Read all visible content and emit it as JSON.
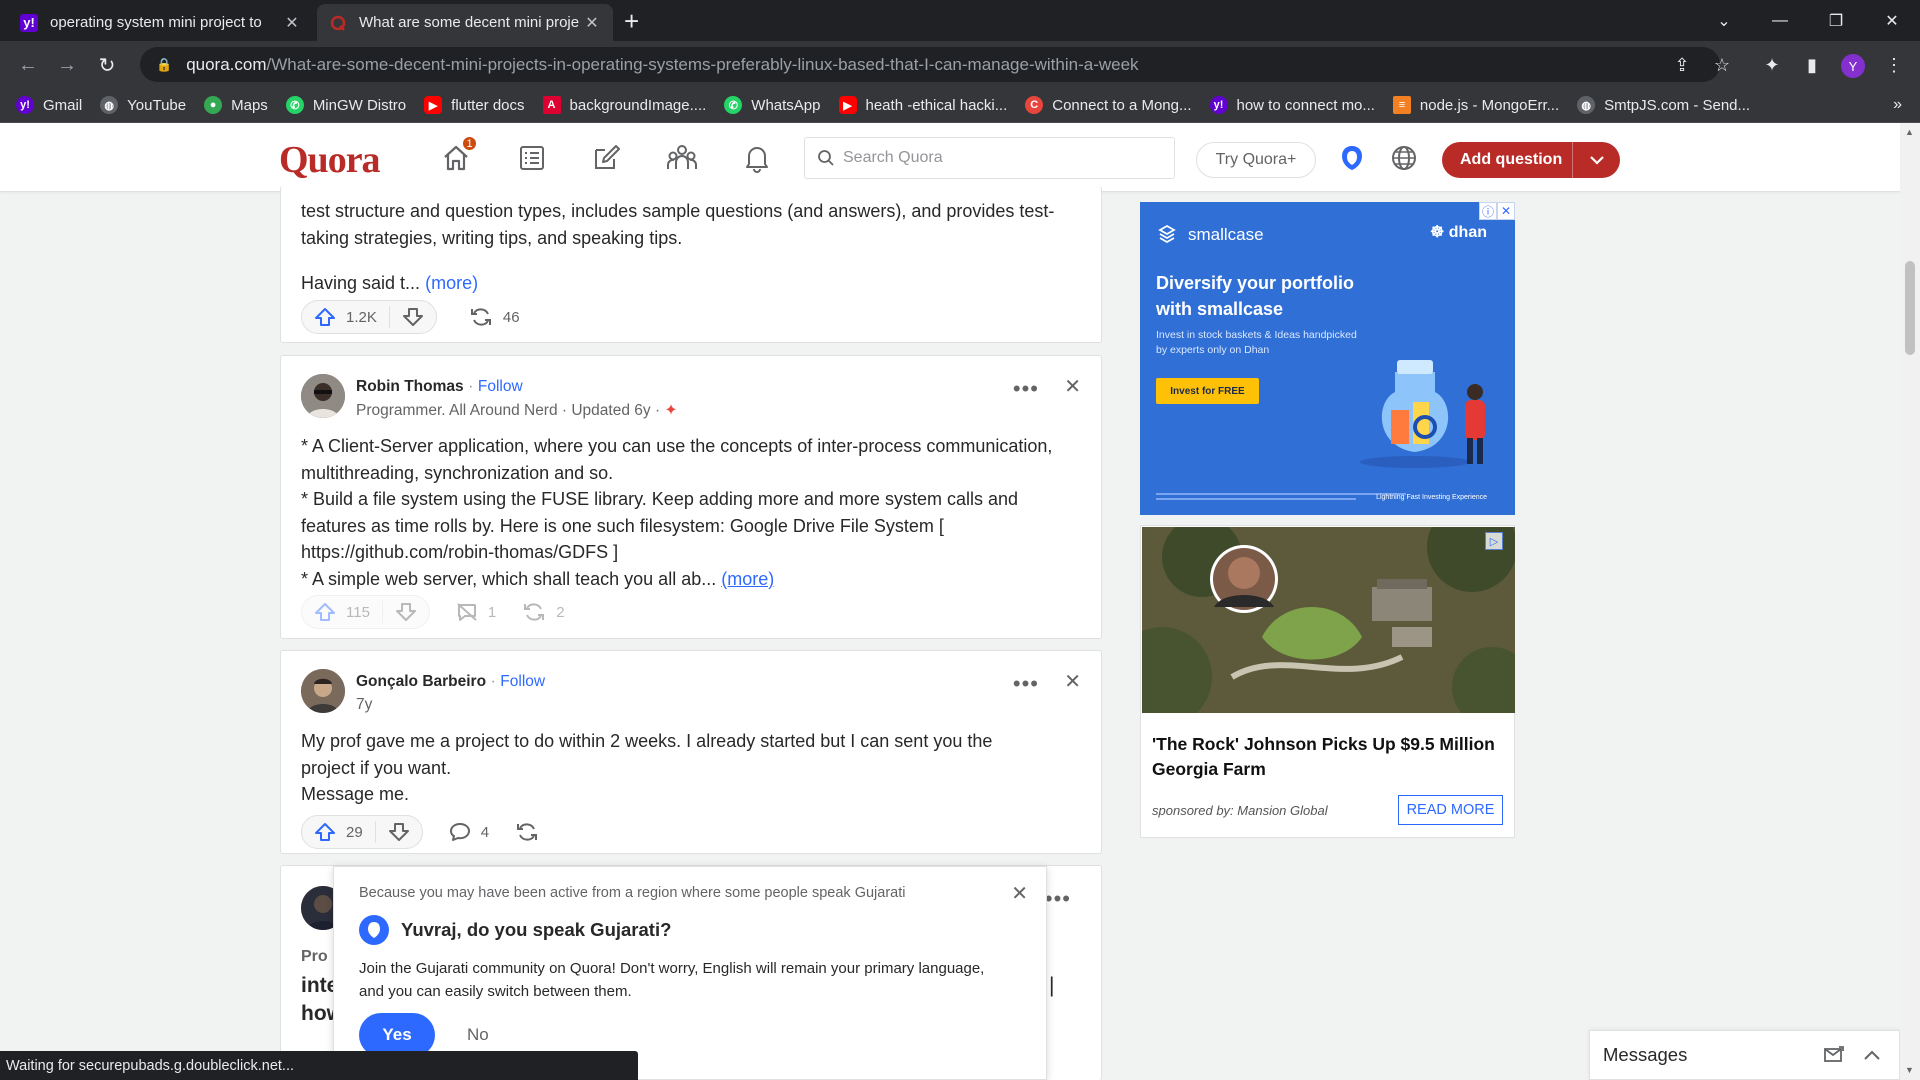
{
  "browser": {
    "tabs": [
      {
        "title": "operating system mini project to",
        "favicon": "yahoo-icon",
        "active": false
      },
      {
        "title": "What are some decent mini proje",
        "favicon": "quora-icon",
        "active": true
      }
    ],
    "url_host": "quora.com",
    "url_path": "/What-are-some-decent-mini-projects-in-operating-systems-preferably-linux-based-that-I-can-manage-within-a-week",
    "profile_initial": "Y",
    "bookmarks": [
      {
        "label": "Gmail",
        "icon": "yahoo-icon",
        "color": "#6001d2"
      },
      {
        "label": "YouTube",
        "icon": "globe-icon",
        "color": "#5f6368"
      },
      {
        "label": "Maps",
        "icon": "maps-pin-icon",
        "color": "#34a853"
      },
      {
        "label": "MinGW Distro",
        "icon": "whatsapp-icon",
        "color": "#25d366"
      },
      {
        "label": "flutter docs",
        "icon": "youtube-icon",
        "color": "#ff0000"
      },
      {
        "label": "backgroundImage....",
        "icon": "angular-icon",
        "color": "#dd0031"
      },
      {
        "label": "WhatsApp",
        "icon": "whatsapp-icon",
        "color": "#25d366"
      },
      {
        "label": "heath -ethical hacki...",
        "icon": "youtube-icon",
        "color": "#ff0000"
      },
      {
        "label": "Connect to a Mong...",
        "icon": "c-icon",
        "color": "#e8453c"
      },
      {
        "label": "how to connect mo...",
        "icon": "yahoo-icon",
        "color": "#6001d2"
      },
      {
        "label": "node.js - MongoErr...",
        "icon": "stackoverflow-icon",
        "color": "#f48024"
      },
      {
        "label": "SmtpJS.com - Send...",
        "icon": "globe-icon",
        "color": "#5f6368"
      }
    ],
    "status_text": "Waiting for securepubads.g.doubleclick.net..."
  },
  "quora": {
    "logo": "Quora",
    "notification_count": "1",
    "search_placeholder": "Search Quora",
    "try_label": "Try Quora+",
    "add_question_label": "Add question",
    "brand_color": "#b92b27"
  },
  "answers": [
    {
      "text_lines": [
        "test structure and question types, includes sample questions (and answers), and provides test-",
        "taking strategies, writing tips, and speaking tips."
      ],
      "text_tail": "Having said t...",
      "more_label": "(more)",
      "upvotes": "1.2K",
      "shares": "46"
    },
    {
      "author": "Robin Thomas",
      "follow_label": "Follow",
      "credential": "Programmer. All Around Nerd · Updated 6y ·",
      "text_lines": [
        "* A Client-Server application, where you can use the concepts of inter-process communication,",
        "multithreading, synchronization and so.",
        "* Build a file system using the FUSE library. Keep adding more and more system calls and",
        "features as time rolls by. Here is one such filesystem: Google Drive File System [",
        "https://github.com/robin-thomas/GDFS ]"
      ],
      "text_tail": "* A simple web server, which shall teach you all ab...",
      "more_label": "(more)",
      "upvotes": "115",
      "comments": "1",
      "shares": "2"
    },
    {
      "author": "Gonçalo Barbeiro",
      "follow_label": "Follow",
      "credential": "7y",
      "text_lines": [
        "My prof gave me a project to do within 2 weeks. I already started but I can sent you the",
        "project if you want.",
        "Message me."
      ],
      "upvotes": "29",
      "comments": "4"
    }
  ],
  "partial_card": {
    "line1": "Pro",
    "line2": "inte",
    "line3": "how"
  },
  "ads": {
    "smallcase": {
      "brand": "smallcase",
      "partner": "dhan",
      "headline": "Diversify your portfolio with smallcase",
      "subtext": "Invest in stock baskets & Ideas handpicked by experts only on Dhan",
      "cta": "Invest for FREE",
      "tagline": "Lightning Fast Investing Experience"
    },
    "mansion": {
      "headline": "'The Rock' Johnson Picks Up $9.5 Million Georgia Farm",
      "sponsor": "sponsored by: Mansion Global",
      "cta": "READ MORE"
    }
  },
  "language_popup": {
    "reason": "Because you may have been active from a region where some people speak Gujarati",
    "question": "Yuvraj, do you speak Gujarati?",
    "description": "Join the Gujarati community on Quora! Don't worry, English will remain your primary language, and you can easily switch between them.",
    "yes_label": "Yes",
    "no_label": "No"
  },
  "messages_label": "Messages"
}
